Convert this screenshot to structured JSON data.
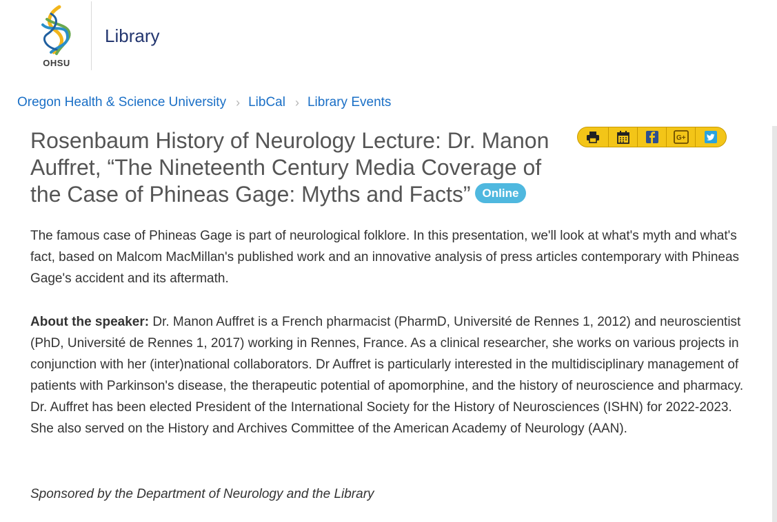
{
  "header": {
    "logo_text": "OHSU",
    "brand": "Library"
  },
  "breadcrumb": [
    {
      "label": "Oregon Health & Science University"
    },
    {
      "label": "LibCal"
    },
    {
      "label": "Library Events"
    }
  ],
  "event": {
    "title": "Rosenbaum History of Neurology Lecture: Dr. Manon Auffret, “The Nineteenth Century Media Coverage of the Case of Phineas Gage: Myths and Facts”",
    "badge": "Online",
    "description": "The famous case of Phineas Gage is part of neurological folklore. In this presentation, we'll look at what's myth and what's fact, based on Malcom MacMillan's published work and an innovative analysis of press articles contemporary with Phineas Gage's accident and its aftermath.",
    "about_label": "About the speaker:",
    "about_text": " Dr. Manon Auffret is a French pharmacist (PharmD, Université de Rennes 1, 2012) and neuroscientist (PhD, Université de Rennes 1, 2017) working in Rennes, France. As a clinical researcher, she works on various projects in conjunction with her (inter)national collaborators. Dr Auffret is particularly interested in the multidisciplinary management of patients with Parkinson's disease, the therapeutic potential of apomorphine, and the history of neuroscience and pharmacy. Dr. Auffret has been elected President of the International Society for the History of Neurosciences (ISHN) for 2022-2023. She also served on the History and Archives Committee of the American Academy of Neurology (AAN).",
    "sponsor": "Sponsored by the Department of Neurology and the Library"
  },
  "toolbar": {
    "buttons": [
      "print-icon",
      "calendar-icon",
      "facebook-icon",
      "google-plus-icon",
      "twitter-icon"
    ]
  },
  "colors": {
    "brand": "#23366f",
    "link": "#1a6fc6",
    "toolbar": "#f3c518",
    "badge": "#4fb8df",
    "title": "#555555"
  }
}
